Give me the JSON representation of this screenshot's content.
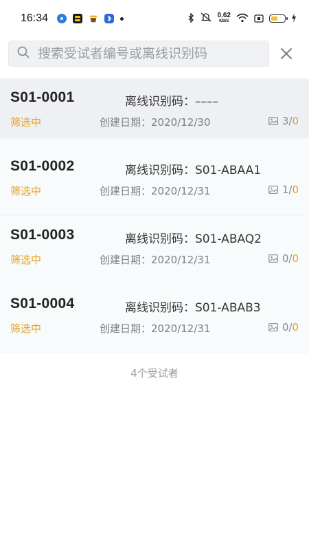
{
  "status_bar": {
    "time": "16:34",
    "app_icons": [
      "circle-app-icon",
      "so-app-icon",
      "cup-app-icon",
      "bluetooth-app-icon"
    ],
    "net_speed_value": "0.62",
    "net_speed_unit": "KB/S",
    "battery_color": "#f2c230"
  },
  "search": {
    "placeholder": "搜索受试者编号或离线识别码"
  },
  "subjects": [
    {
      "id": "S01-0001",
      "offline_label": "离线识别码：",
      "offline_code": "––––",
      "status": "筛选中",
      "created_label": "创建日期：",
      "created_date": "2020/12/30",
      "photos_done": "3",
      "photos_sep": "/",
      "photos_pending": "0"
    },
    {
      "id": "S01-0002",
      "offline_label": "离线识别码：",
      "offline_code": "S01-ABAA1",
      "status": "筛选中",
      "created_label": "创建日期：",
      "created_date": "2020/12/31",
      "photos_done": "1",
      "photos_sep": "/",
      "photos_pending": "0"
    },
    {
      "id": "S01-0003",
      "offline_label": "离线识别码：",
      "offline_code": "S01-ABAQ2",
      "status": "筛选中",
      "created_label": "创建日期：",
      "created_date": "2020/12/31",
      "photos_done": "0",
      "photos_sep": "/",
      "photos_pending": "0"
    },
    {
      "id": "S01-0004",
      "offline_label": "离线识别码：",
      "offline_code": "S01-ABAB3",
      "status": "筛选中",
      "created_label": "创建日期：",
      "created_date": "2020/12/31",
      "photos_done": "0",
      "photos_sep": "/",
      "photos_pending": "0"
    }
  ],
  "footer": {
    "count_text": "4个受试者"
  },
  "colors": {
    "status_accent": "#e5a21a",
    "selected_row_bg": "#eef0f4",
    "row_bg": "#f7fbfc"
  }
}
